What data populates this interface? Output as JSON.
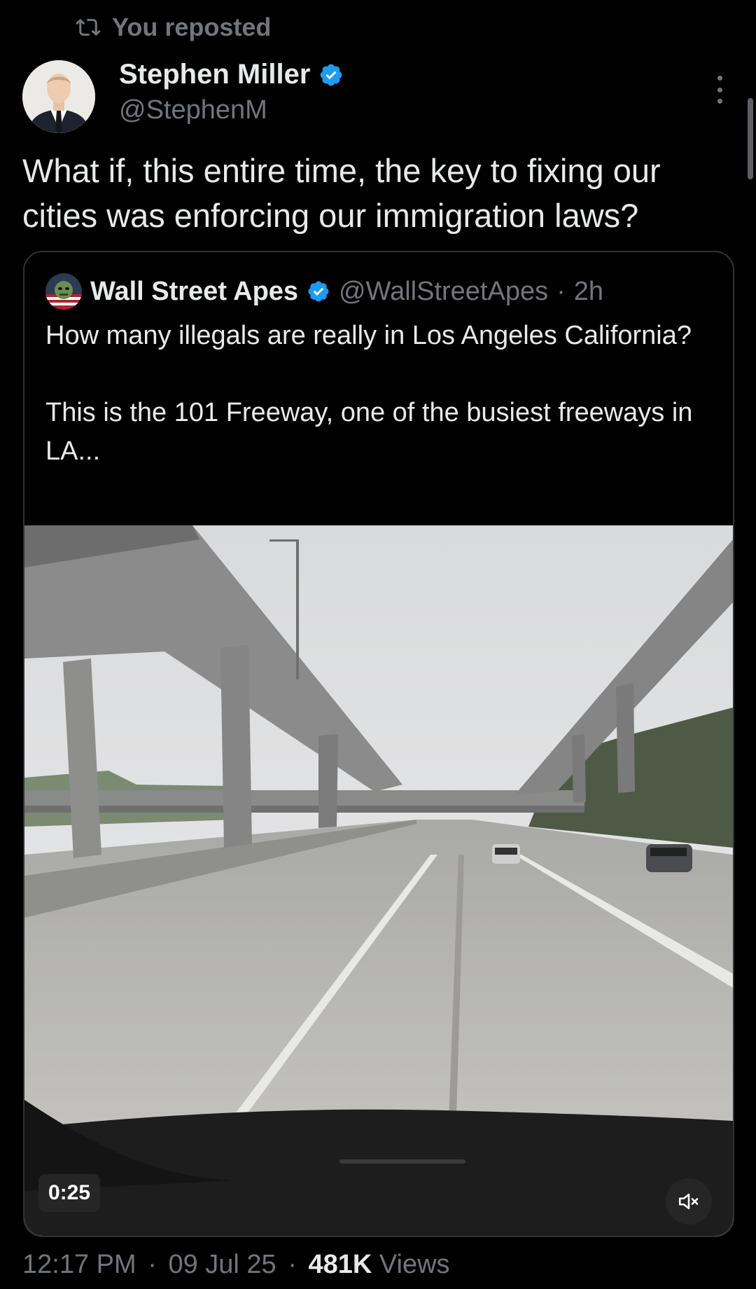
{
  "repost": {
    "label": "You reposted",
    "icon": "repost-icon"
  },
  "author": {
    "name": "Stephen Miller",
    "handle": "@StephenM",
    "verified_icon": "verified-badge-icon",
    "avatar_icon": "avatar"
  },
  "tweet": {
    "text": "What if, this entire time, the key to fixing our cities was enforcing our immigration laws?"
  },
  "quote": {
    "name": "Wall Street Apes",
    "handle": "@WallStreetApes",
    "separator": "·",
    "time": "2h",
    "text": "How many illegals are really in Los Angeles California?\n\nThis is the 101 Freeway, one of the busiest freeways in LA...",
    "video": {
      "duration": "0:25",
      "mute_icon": "mute-icon"
    }
  },
  "meta": {
    "time": "12:17 PM",
    "sep1": "·",
    "date": "09 Jul 25",
    "sep2": "·",
    "views_count": "481K",
    "views_label": "Views"
  },
  "colors": {
    "background": "#000000",
    "text": "#e7e9ea",
    "muted": "#71767b",
    "verified": "#1d9bf0",
    "border": "#2f3336"
  }
}
